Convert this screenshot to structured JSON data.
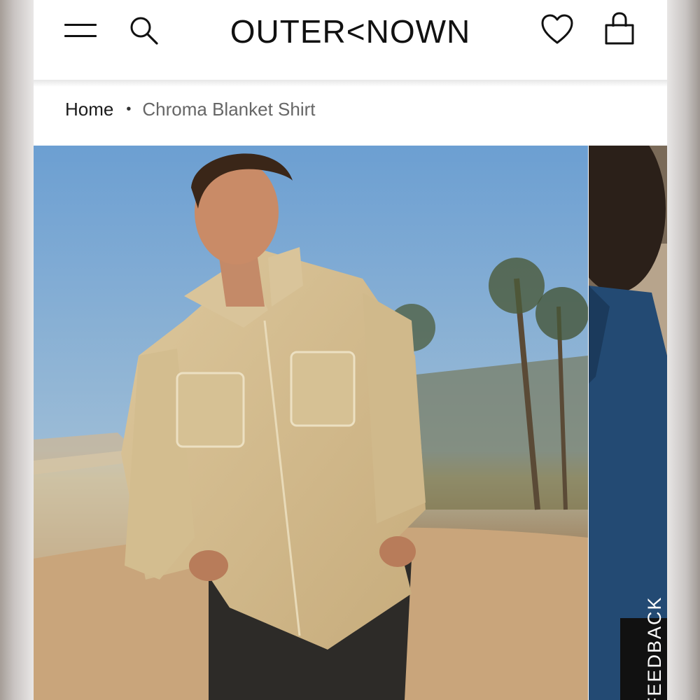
{
  "header": {
    "logo": "OUTER<NOWN",
    "menu_icon": "hamburger-menu-icon",
    "search_icon": "search-icon",
    "wishlist_icon": "heart-icon",
    "bag_icon": "shopping-bag-icon"
  },
  "breadcrumb": {
    "home": "Home",
    "separator": "•",
    "current": "Chroma Blanket Shirt"
  },
  "gallery": {
    "main_image": "man in tan blanket shirt on beach",
    "next_image": "man in blue shirt"
  },
  "feedback": {
    "label": "FEEDBACK"
  },
  "colors": {
    "text": "#111111",
    "breadcrumb_current": "#666666",
    "feedback_bg": "#111111"
  }
}
